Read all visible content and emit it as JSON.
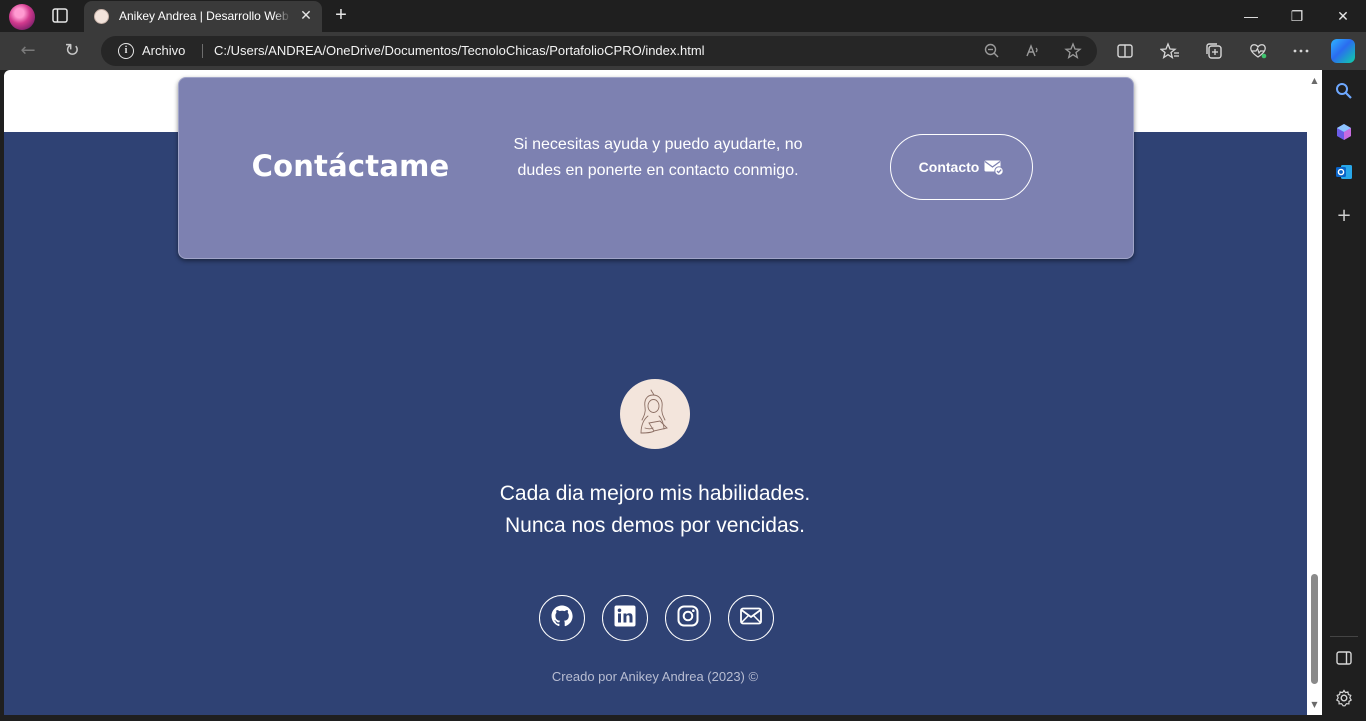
{
  "browser": {
    "tab": {
      "title": "Anikey Andrea | Desarrollo Web Frontend",
      "close": "✕"
    },
    "new_tab": "+",
    "window": {
      "minimize": "—",
      "restore": "❐",
      "close": "✕"
    },
    "nav": {
      "back": "←",
      "refresh": "↻"
    },
    "address": {
      "site_label": "Archivo",
      "url": "C:/Users/ANDREA/OneDrive/Documentos/TecnoloChicas/PortafolioCPRO/index.html"
    },
    "omnibox_icons": [
      "zoom-out-icon",
      "read-aloud-icon",
      "favorite-star-icon"
    ],
    "toolbar_icons": [
      "split-screen-icon",
      "favorites-icon",
      "collections-icon",
      "performance-icon",
      "more-icon",
      "copilot-icon"
    ],
    "sidebar_icons": [
      "search-icon",
      "copilot-app-icon",
      "outlook-icon",
      "add-icon",
      "sidebar-toggle-icon",
      "settings-icon"
    ]
  },
  "page": {
    "contact": {
      "title": "Contáctame",
      "description": "Si necesitas ayuda y puedo ayudarte, no dudes en ponerte en contacto conmigo.",
      "button_label": "Contacto"
    },
    "footer": {
      "tagline_line1": "Cada dia mejoro mis habilidades.",
      "tagline_line2": "Nunca nos demos por vencidas.",
      "social": [
        "github-icon",
        "linkedin-icon",
        "instagram-icon",
        "mail-icon"
      ],
      "credit": "Creado por Anikey Andrea (2023) ©"
    }
  },
  "colors": {
    "page_background": "#2f4274",
    "contact_card": "#7d81b1",
    "avatar_background": "#f3e5dc",
    "text": "#ffffff"
  }
}
